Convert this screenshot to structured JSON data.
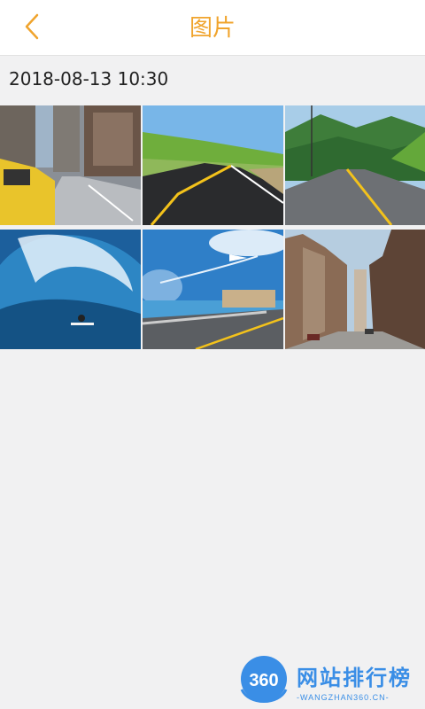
{
  "header": {
    "title": "图片",
    "back_icon": "chevron-left-icon",
    "accent_color": "#f0a42d"
  },
  "gallery": {
    "date": "2018-08-13 10:30",
    "photos": [
      {
        "name": "city-taxi-street-photo"
      },
      {
        "name": "countryside-road-photo"
      },
      {
        "name": "mountain-highway-photo"
      },
      {
        "name": "surfer-wave-photo"
      },
      {
        "name": "airplane-coast-road-photo"
      },
      {
        "name": "old-town-street-photo"
      }
    ]
  },
  "watermark": {
    "badge": "360",
    "title": "网站排行榜",
    "subtitle": "-WANGZHAN360.CN-"
  }
}
